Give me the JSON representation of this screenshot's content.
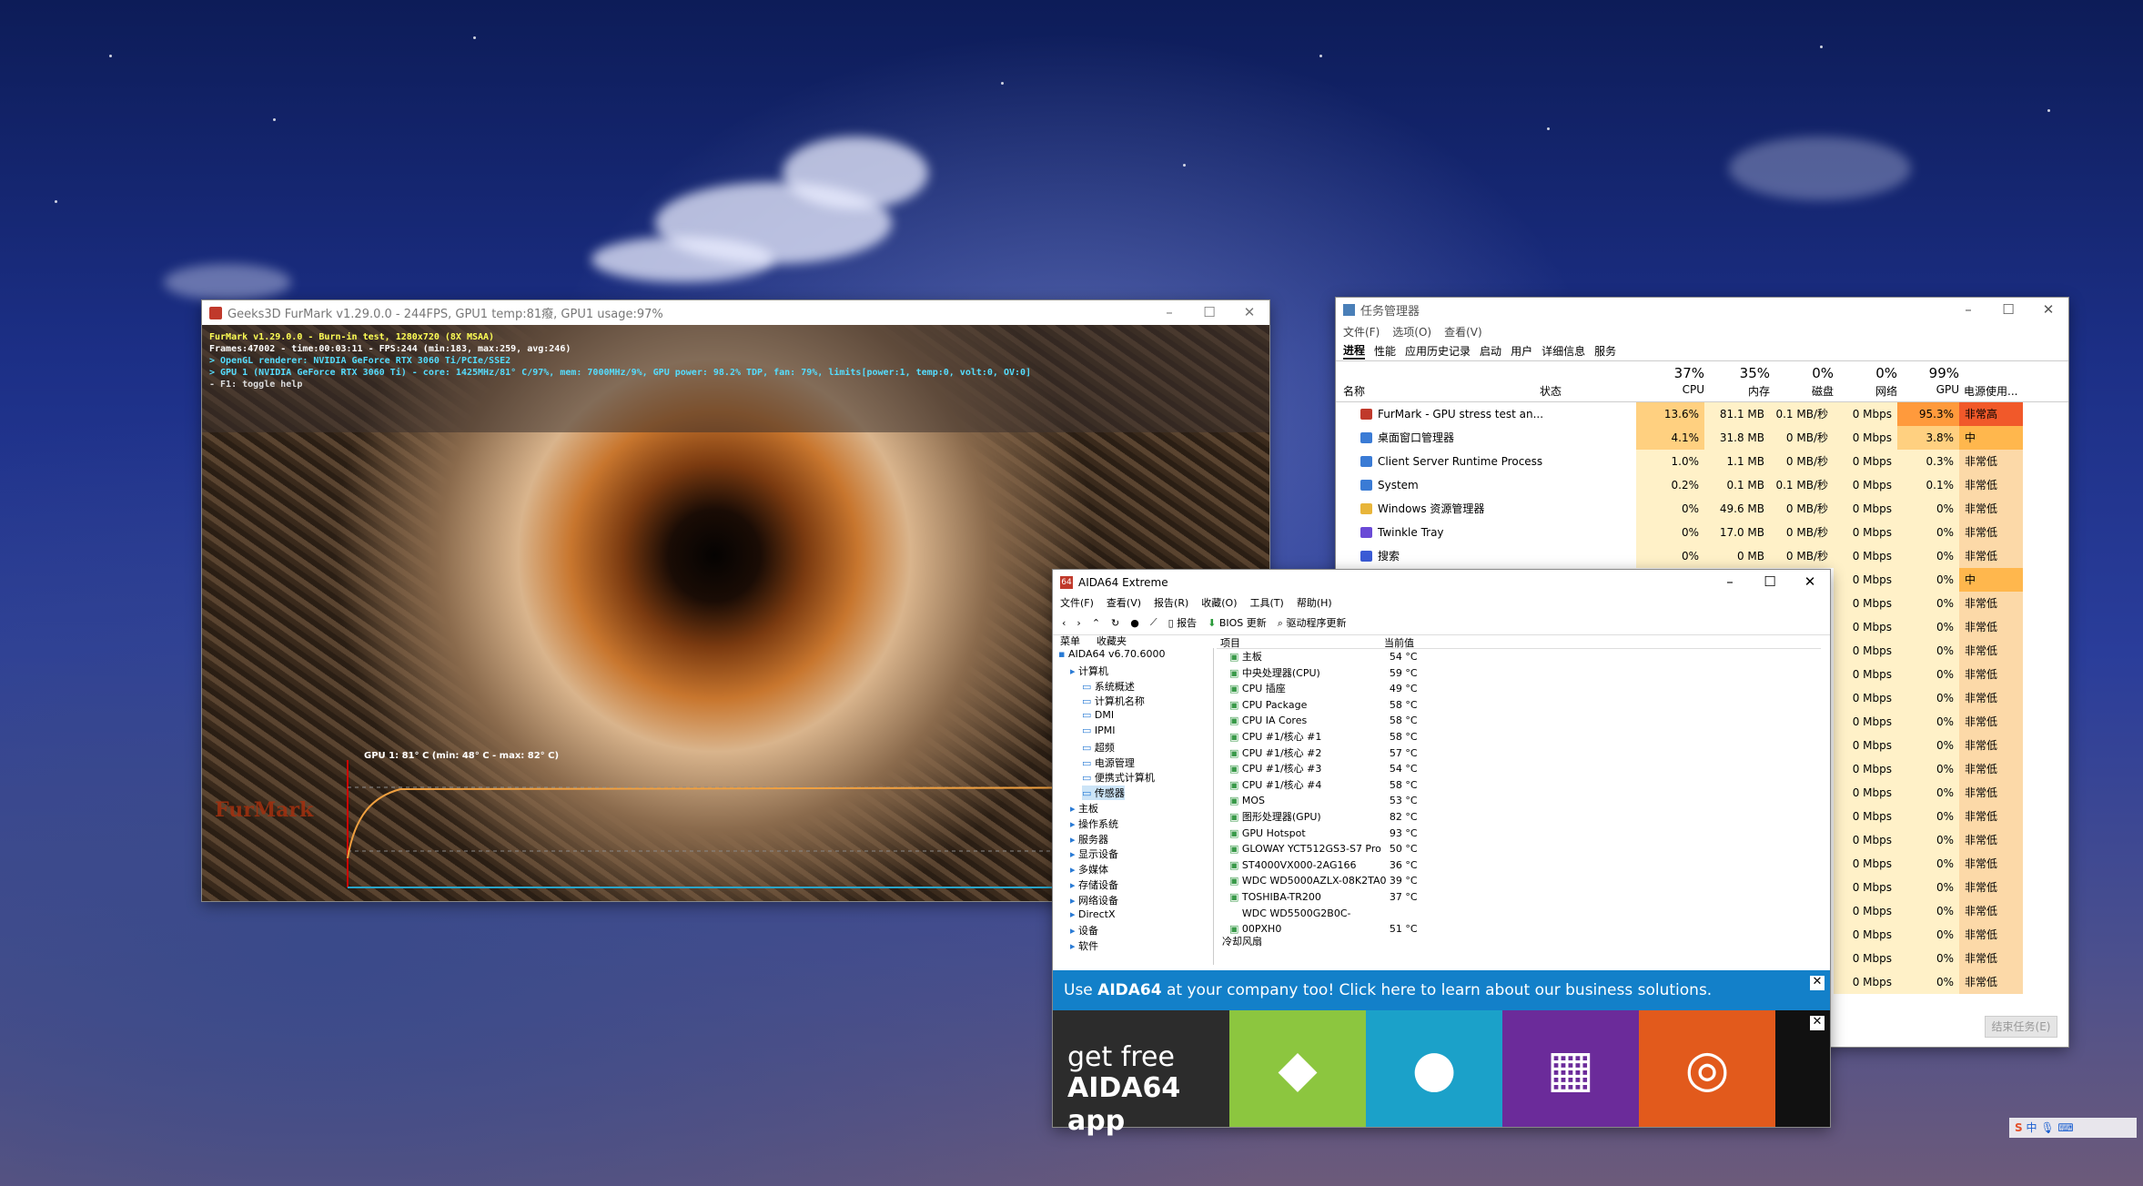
{
  "furmark": {
    "title": "Geeks3D FurMark v1.29.0.0 - 244FPS, GPU1 temp:81癈, GPU1 usage:97%",
    "overlay": [
      {
        "text": "FurMark v1.29.0.0 - Burn-in test, 1280x720 (8X MSAA)",
        "color": "#ffff55"
      },
      {
        "text": "Frames:47002 - time:00:03:11 - FPS:244 (min:183, max:259, avg:246)",
        "color": "#ffffff"
      },
      {
        "text": "> OpenGL renderer: NVIDIA GeForce RTX 3060 Ti/PCIe/SSE2",
        "color": "#55ddff"
      },
      {
        "text": "> GPU 1 (NVIDIA GeForce RTX 3060 Ti) - core: 1425MHz/81° C/97%, mem: 7000MHz/9%, GPU power: 98.2% TDP, fan: 79%, limits[power:1, temp:0, volt:0, OV:0]",
        "color": "#55ddff"
      },
      {
        "text": "- F1: toggle help",
        "color": "#dddddd"
      }
    ],
    "graph_label": "GPU 1: 81° C (min: 48° C - max: 82° C)",
    "logo": "FurMark"
  },
  "taskmgr": {
    "title": "任务管理器",
    "menu": [
      "文件(F)",
      "选项(O)",
      "查看(V)"
    ],
    "tabs": [
      "进程",
      "性能",
      "应用历史记录",
      "启动",
      "用户",
      "详细信息",
      "服务"
    ],
    "columns": {
      "name": "名称",
      "status": "状态",
      "cpu_pct": "37%",
      "cpu": "CPU",
      "mem_pct": "35%",
      "mem": "内存",
      "disk_pct": "0%",
      "disk": "磁盘",
      "net_pct": "0%",
      "net": "网络",
      "gpu_pct": "99%",
      "gpu": "GPU",
      "power": "电源使用..."
    },
    "rows": [
      {
        "name": "FurMark - GPU stress test an...",
        "cpu": "13.6%",
        "mem": "81.1 MB",
        "disk": "0.1 MB/秒",
        "net": "0 Mbps",
        "gpu": "95.3%",
        "power": "非常高",
        "icon": "#c0392b"
      },
      {
        "name": "桌面窗口管理器",
        "cpu": "4.1%",
        "mem": "31.8 MB",
        "disk": "0 MB/秒",
        "net": "0 Mbps",
        "gpu": "3.8%",
        "power": "中",
        "icon": "#3a7bd5"
      },
      {
        "name": "Client Server Runtime Process",
        "cpu": "1.0%",
        "mem": "1.1 MB",
        "disk": "0 MB/秒",
        "net": "0 Mbps",
        "gpu": "0.3%",
        "power": "非常低",
        "icon": "#3a7bd5"
      },
      {
        "name": "System",
        "cpu": "0.2%",
        "mem": "0.1 MB",
        "disk": "0.1 MB/秒",
        "net": "0 Mbps",
        "gpu": "0.1%",
        "power": "非常低",
        "icon": "#3a7bd5"
      },
      {
        "name": "Windows 资源管理器",
        "cpu": "0%",
        "mem": "49.6 MB",
        "disk": "0 MB/秒",
        "net": "0 Mbps",
        "gpu": "0%",
        "power": "非常低",
        "icon": "#e8b53a"
      },
      {
        "name": "Twinkle Tray",
        "cpu": "0%",
        "mem": "17.0 MB",
        "disk": "0 MB/秒",
        "net": "0 Mbps",
        "gpu": "0%",
        "power": "非常低",
        "icon": "#6a4ad6"
      },
      {
        "name": "搜索",
        "cpu": "0%",
        "mem": "0 MB",
        "disk": "0 MB/秒",
        "net": "0 Mbps",
        "gpu": "0%",
        "power": "非常低",
        "icon": "#3a5bd5"
      }
    ],
    "hidden_rows": [
      {
        "net": "0 Mbps",
        "gpu": "0%",
        "power": "中"
      },
      {
        "net": "0 Mbps",
        "gpu": "0%",
        "power": "非常低"
      },
      {
        "net": "0 Mbps",
        "gpu": "0%",
        "power": "非常低"
      },
      {
        "net": "0 Mbps",
        "gpu": "0%",
        "power": "非常低"
      },
      {
        "net": "0 Mbps",
        "gpu": "0%",
        "power": "非常低"
      },
      {
        "net": "0 Mbps",
        "gpu": "0%",
        "power": "非常低"
      },
      {
        "net": "0 Mbps",
        "gpu": "0%",
        "power": "非常低"
      },
      {
        "net": "0 Mbps",
        "gpu": "0%",
        "power": "非常低"
      },
      {
        "net": "0 Mbps",
        "gpu": "0%",
        "power": "非常低"
      },
      {
        "net": "0 Mbps",
        "gpu": "0%",
        "power": "非常低"
      },
      {
        "net": "0 Mbps",
        "gpu": "0%",
        "power": "非常低"
      },
      {
        "net": "0 Mbps",
        "gpu": "0%",
        "power": "非常低"
      },
      {
        "net": "0 Mbps",
        "gpu": "0%",
        "power": "非常低"
      },
      {
        "net": "0 Mbps",
        "gpu": "0%",
        "power": "非常低"
      },
      {
        "net": "0 Mbps",
        "gpu": "0%",
        "power": "非常低"
      },
      {
        "net": "0 Mbps",
        "gpu": "0%",
        "power": "非常低"
      },
      {
        "net": "0 Mbps",
        "gpu": "0%",
        "power": "非常低"
      },
      {
        "net": "0 Mbps",
        "gpu": "0%",
        "power": "非常低"
      }
    ],
    "end_task": "结束任务(E)"
  },
  "aida": {
    "title": "AIDA64 Extreme",
    "menu": [
      "文件(F)",
      "查看(V)",
      "报告(R)",
      "收藏(O)",
      "工具(T)",
      "帮助(H)"
    ],
    "toolbar": {
      "report": "报告",
      "bios": "BIOS 更新",
      "driver": "驱动程序更新"
    },
    "left_tabs": [
      "菜单",
      "收藏夹"
    ],
    "tree": [
      {
        "label": "AIDA64 v6.70.6000",
        "level": 0
      },
      {
        "label": "计算机",
        "level": 1
      },
      {
        "label": "系统概述",
        "level": 2
      },
      {
        "label": "计算机名称",
        "level": 2
      },
      {
        "label": "DMI",
        "level": 2
      },
      {
        "label": "IPMI",
        "level": 2
      },
      {
        "label": "超频",
        "level": 2
      },
      {
        "label": "电源管理",
        "level": 2
      },
      {
        "label": "便携式计算机",
        "level": 2
      },
      {
        "label": "传感器",
        "level": 2
      },
      {
        "label": "主板",
        "level": 1
      },
      {
        "label": "操作系统",
        "level": 1
      },
      {
        "label": "服务器",
        "level": 1
      },
      {
        "label": "显示设备",
        "level": 1
      },
      {
        "label": "多媒体",
        "level": 1
      },
      {
        "label": "存储设备",
        "level": 1
      },
      {
        "label": "网络设备",
        "level": 1
      },
      {
        "label": "DirectX",
        "level": 1
      },
      {
        "label": "设备",
        "level": 1
      },
      {
        "label": "软件",
        "level": 1
      }
    ],
    "columns": {
      "item": "项目",
      "value": "当前值"
    },
    "sensors": [
      {
        "name": "主板",
        "value": "54 °C"
      },
      {
        "name": "中央处理器(CPU)",
        "value": "59 °C"
      },
      {
        "name": "CPU 插座",
        "value": "49 °C"
      },
      {
        "name": "CPU Package",
        "value": "58 °C"
      },
      {
        "name": "CPU IA Cores",
        "value": "58 °C"
      },
      {
        "name": "CPU #1/核心 #1",
        "value": "58 °C"
      },
      {
        "name": "CPU #1/核心 #2",
        "value": "57 °C"
      },
      {
        "name": "CPU #1/核心 #3",
        "value": "54 °C"
      },
      {
        "name": "CPU #1/核心 #4",
        "value": "58 °C"
      },
      {
        "name": "MOS",
        "value": "53 °C"
      },
      {
        "name": "图形处理器(GPU)",
        "value": "82 °C"
      },
      {
        "name": "GPU Hotspot",
        "value": "93 °C"
      },
      {
        "name": "GLOWAY YCT512GS3-S7 Pro",
        "value": "50 °C"
      },
      {
        "name": "ST4000VX000-2AG166",
        "value": "36 °C"
      },
      {
        "name": "WDC WD5000AZLX-08K2TA0",
        "value": "39 °C"
      },
      {
        "name": "TOSHIBA-TR200",
        "value": "37 °C"
      },
      {
        "name": "WDC WD5500G2B0C-00PXH0",
        "value": "51 °C"
      }
    ],
    "section": "冷却风扇",
    "banner": {
      "pre": "Use ",
      "brand": "AIDA64",
      "post": " at your company too! Click here to learn about our business solutions."
    },
    "app_promo": {
      "line1": "get free",
      "line2": "AIDA64 app"
    },
    "tile_colors": [
      "#8cc63f",
      "#1ba1c9",
      "#6b2b9a",
      "#e25a1c"
    ]
  }
}
